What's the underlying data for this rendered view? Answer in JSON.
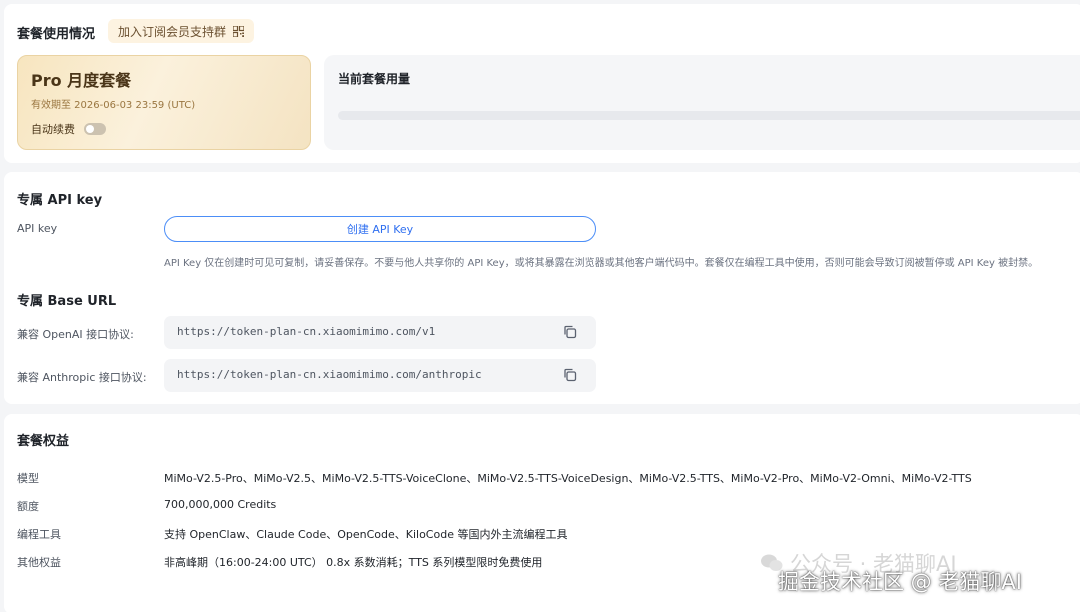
{
  "plan_section": {
    "title": "套餐使用情况",
    "join_button_label": "加入订阅会员支持群",
    "join_button_icon": "qr-code-icon",
    "plan_name": "Pro 月度套餐",
    "valid_until": "有效期至 2026-06-03 23:59 (UTC)",
    "auto_renew_label": "自动续费",
    "auto_renew_enabled": false,
    "usage_title": "当前套餐用量",
    "usage_fraction": 0
  },
  "api_section": {
    "title": "专属 API key",
    "api_key_label": "API key",
    "create_button_label": "创建 API Key",
    "note": "API Key 仅在创建时可见可复制，请妥善保存。不要与他人共享你的 API Key，或将其暴露在浏览器或其他客户端代码中。套餐仅在编程工具中使用，否则可能会导致订阅被暂停或 API Key 被封禁。",
    "base_url_title": "专属 Base URL",
    "openai_label": "兼容 OpenAI 接口协议:",
    "openai_url": "https://token-plan-cn.xiaomimimo.com/v1",
    "anthropic_label": "兼容 Anthropic 接口协议:",
    "anthropic_url": "https://token-plan-cn.xiaomimimo.com/anthropic",
    "copy_icon": "copy-icon"
  },
  "benefits_section": {
    "title": "套餐权益",
    "rows": [
      {
        "label": "模型",
        "value": "MiMo-V2.5-Pro、MiMo-V2.5、MiMo-V2.5-TTS-VoiceClone、MiMo-V2.5-TTS-VoiceDesign、MiMo-V2.5-TTS、MiMo-V2-Pro、MiMo-V2-Omni、MiMo-V2-TTS"
      },
      {
        "label": "额度",
        "value": "700,000,000 Credits"
      },
      {
        "label": "编程工具",
        "value": "支持 OpenClaw、Claude Code、OpenCode、KiloCode 等国内外主流编程工具"
      },
      {
        "label": "其他权益",
        "value": "非高峰期（16:00-24:00 UTC） 0.8x 系数消耗；TTS 系列模型限时免费使用"
      }
    ]
  },
  "watermark": {
    "line1": "公众号 · 老猫聊AI",
    "line2": "掘金技术社区 @ 老猫聊AI"
  },
  "colors": {
    "accent_blue": "#2f6ff0",
    "gold": "#c9a56c",
    "page_bg": "#f4f5f7"
  }
}
